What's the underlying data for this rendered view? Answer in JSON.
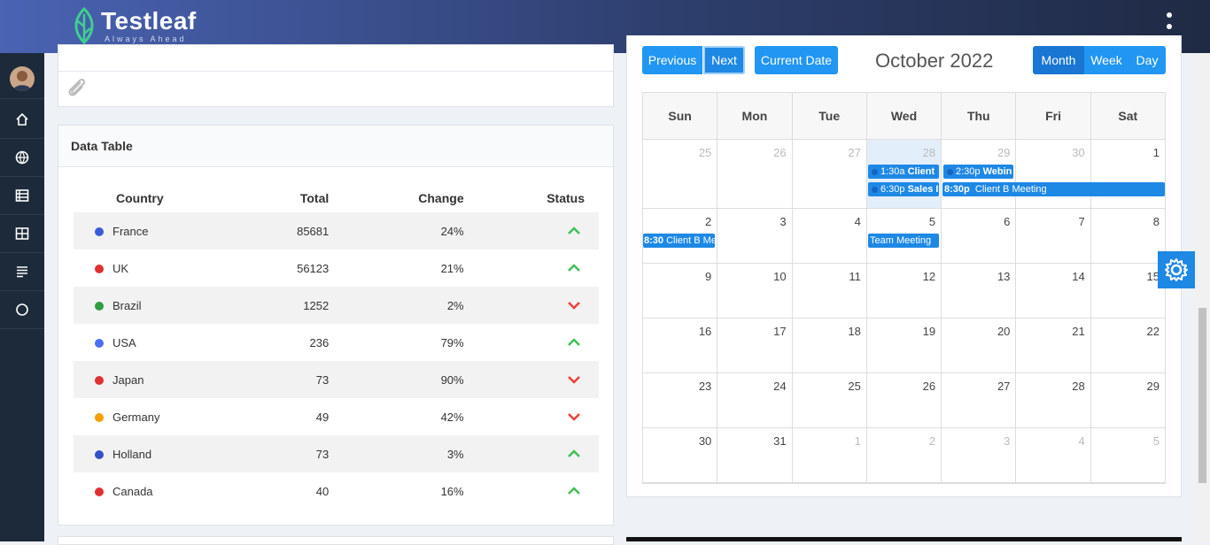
{
  "brand": {
    "name": "Testleaf",
    "tagline": "Always Ahead"
  },
  "sidebar": {
    "items": [
      "avatar",
      "home-icon",
      "globe-icon",
      "list-icon",
      "grid-icon",
      "text-icon",
      "circle-icon"
    ]
  },
  "data_table": {
    "title": "Data Table",
    "columns": [
      "Country",
      "Total",
      "Change",
      "Status"
    ],
    "rows": [
      {
        "country": "France",
        "total": "85681",
        "change": "24%",
        "status": "up",
        "flag": "#3b5bdb"
      },
      {
        "country": "UK",
        "total": "56123",
        "change": "21%",
        "status": "up",
        "flag": "#e03131"
      },
      {
        "country": "Brazil",
        "total": "1252",
        "change": "2%",
        "status": "down",
        "flag": "#2f9e44"
      },
      {
        "country": "USA",
        "total": "236",
        "change": "79%",
        "status": "up",
        "flag": "#4c6ef5"
      },
      {
        "country": "Japan",
        "total": "73",
        "change": "90%",
        "status": "down",
        "flag": "#e03131"
      },
      {
        "country": "Germany",
        "total": "49",
        "change": "42%",
        "status": "down",
        "flag": "#f59f00"
      },
      {
        "country": "Holland",
        "total": "73",
        "change": "3%",
        "status": "up",
        "flag": "#364fc7"
      },
      {
        "country": "Canada",
        "total": "40",
        "change": "16%",
        "status": "up",
        "flag": "#e03131"
      }
    ]
  },
  "calendar": {
    "buttons": {
      "previous": "Previous",
      "next": "Next",
      "current": "Current Date",
      "month": "Month",
      "week": "Week",
      "day": "Day"
    },
    "title": "October 2022",
    "weekdays": [
      "Sun",
      "Mon",
      "Tue",
      "Wed",
      "Thu",
      "Fri",
      "Sat"
    ],
    "weeks": [
      [
        "25",
        "26",
        "27",
        "28",
        "29",
        "30",
        "1"
      ],
      [
        "2",
        "3",
        "4",
        "5",
        "6",
        "7",
        "8"
      ],
      [
        "9",
        "10",
        "11",
        "12",
        "13",
        "14",
        "15"
      ],
      [
        "16",
        "17",
        "18",
        "19",
        "20",
        "21",
        "22"
      ],
      [
        "23",
        "24",
        "25",
        "26",
        "27",
        "28",
        "29"
      ],
      [
        "30",
        "31",
        "1",
        "2",
        "3",
        "4",
        "5"
      ]
    ],
    "events": {
      "e1": {
        "time": "1:30a",
        "title": "Client"
      },
      "e2": {
        "time": "2:30p",
        "title": "Webin"
      },
      "e3": {
        "time": "6:30p",
        "title": "Sales I"
      },
      "e4": {
        "time": "8:30p",
        "title": "Client B Meeting"
      },
      "e5": {
        "time": "8:30",
        "title": "Client B Me"
      },
      "e6": {
        "title": "Team Meeting"
      }
    }
  },
  "colors": {
    "accent": "#2196f3",
    "up": "#40c057",
    "down": "#f03e3e"
  }
}
